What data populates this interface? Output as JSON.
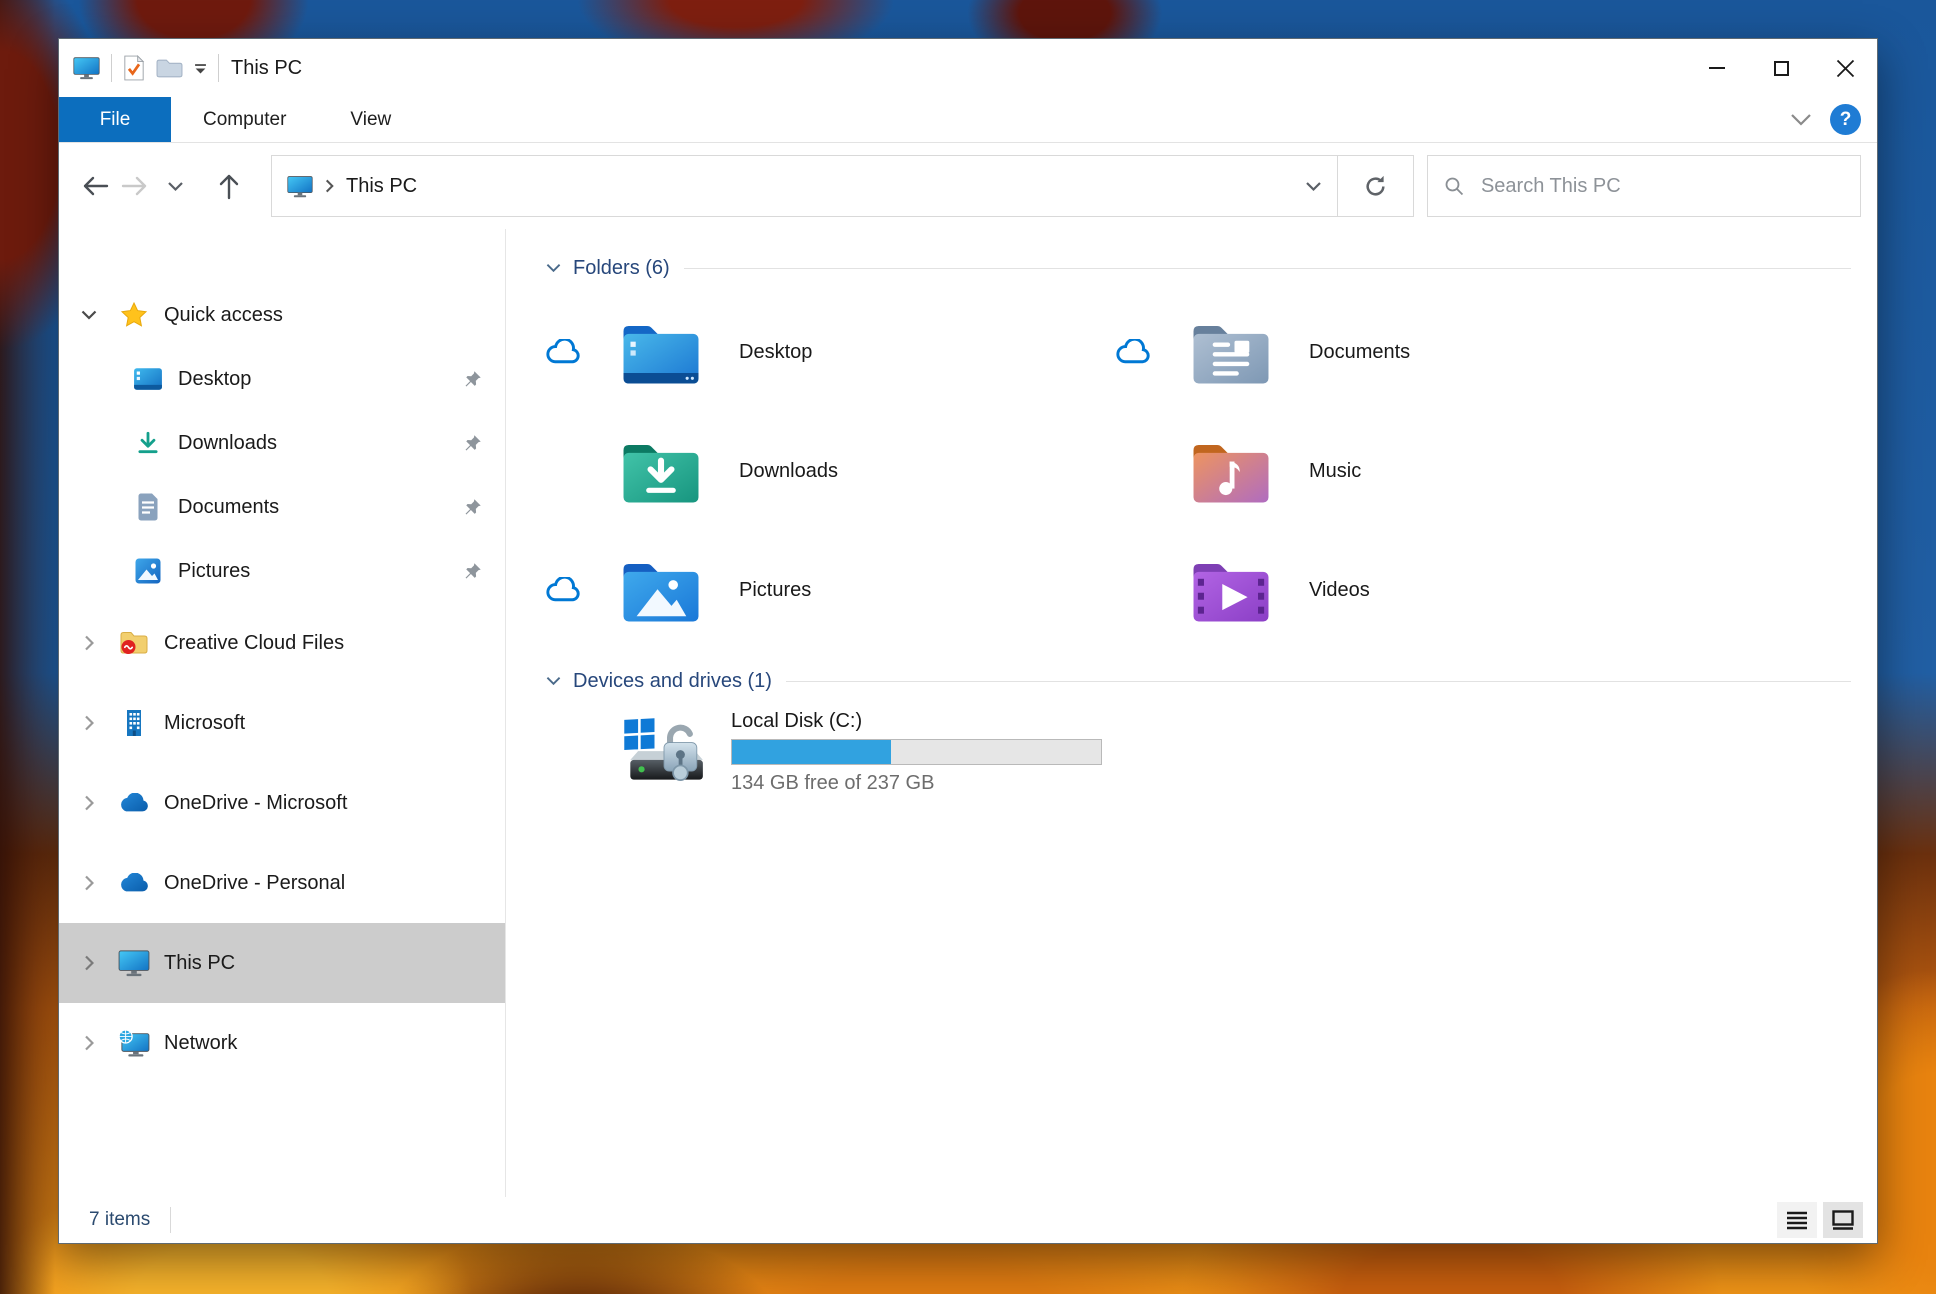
{
  "titlebar": {
    "title": "This PC"
  },
  "ribbon": {
    "tabs": [
      {
        "label": "File"
      },
      {
        "label": "Computer"
      },
      {
        "label": "View"
      }
    ],
    "active_tab": "File",
    "help_label": "?"
  },
  "navigation": {
    "breadcrumb_root": "This PC",
    "search_placeholder": "Search This PC"
  },
  "sidebar": {
    "quick_access": {
      "label": "Quick access"
    },
    "quick_access_items": [
      {
        "label": "Desktop",
        "pinned": true
      },
      {
        "label": "Downloads",
        "pinned": true
      },
      {
        "label": "Documents",
        "pinned": true
      },
      {
        "label": "Pictures",
        "pinned": true
      }
    ],
    "root_items": [
      {
        "label": "Creative Cloud Files"
      },
      {
        "label": "Microsoft"
      },
      {
        "label": "OneDrive - Microsoft"
      },
      {
        "label": "OneDrive - Personal"
      },
      {
        "label": "This PC",
        "selected": true
      },
      {
        "label": "Network"
      }
    ]
  },
  "content": {
    "folders_group": {
      "title": "Folders (6)",
      "items": [
        {
          "label": "Desktop",
          "cloud_status": true
        },
        {
          "label": "Documents",
          "cloud_status": true
        },
        {
          "label": "Downloads",
          "cloud_status": false
        },
        {
          "label": "Music",
          "cloud_status": false
        },
        {
          "label": "Pictures",
          "cloud_status": true
        },
        {
          "label": "Videos",
          "cloud_status": false
        }
      ]
    },
    "drives_group": {
      "title": "Devices and drives (1)",
      "drive": {
        "label": "Local Disk (C:)",
        "free_space_text": "134 GB free of 237 GB",
        "used_percent": 43,
        "fill_style": "width:43%"
      }
    }
  },
  "statusbar": {
    "items_count": "7 items"
  },
  "colors": {
    "file_tab_blue": "#0c6ebe",
    "progress_fill": "#31a2e0",
    "selection_gray": "#cccccc",
    "group_header_blue": "#27477b",
    "onedrive_blue": "#0e6fc4"
  }
}
